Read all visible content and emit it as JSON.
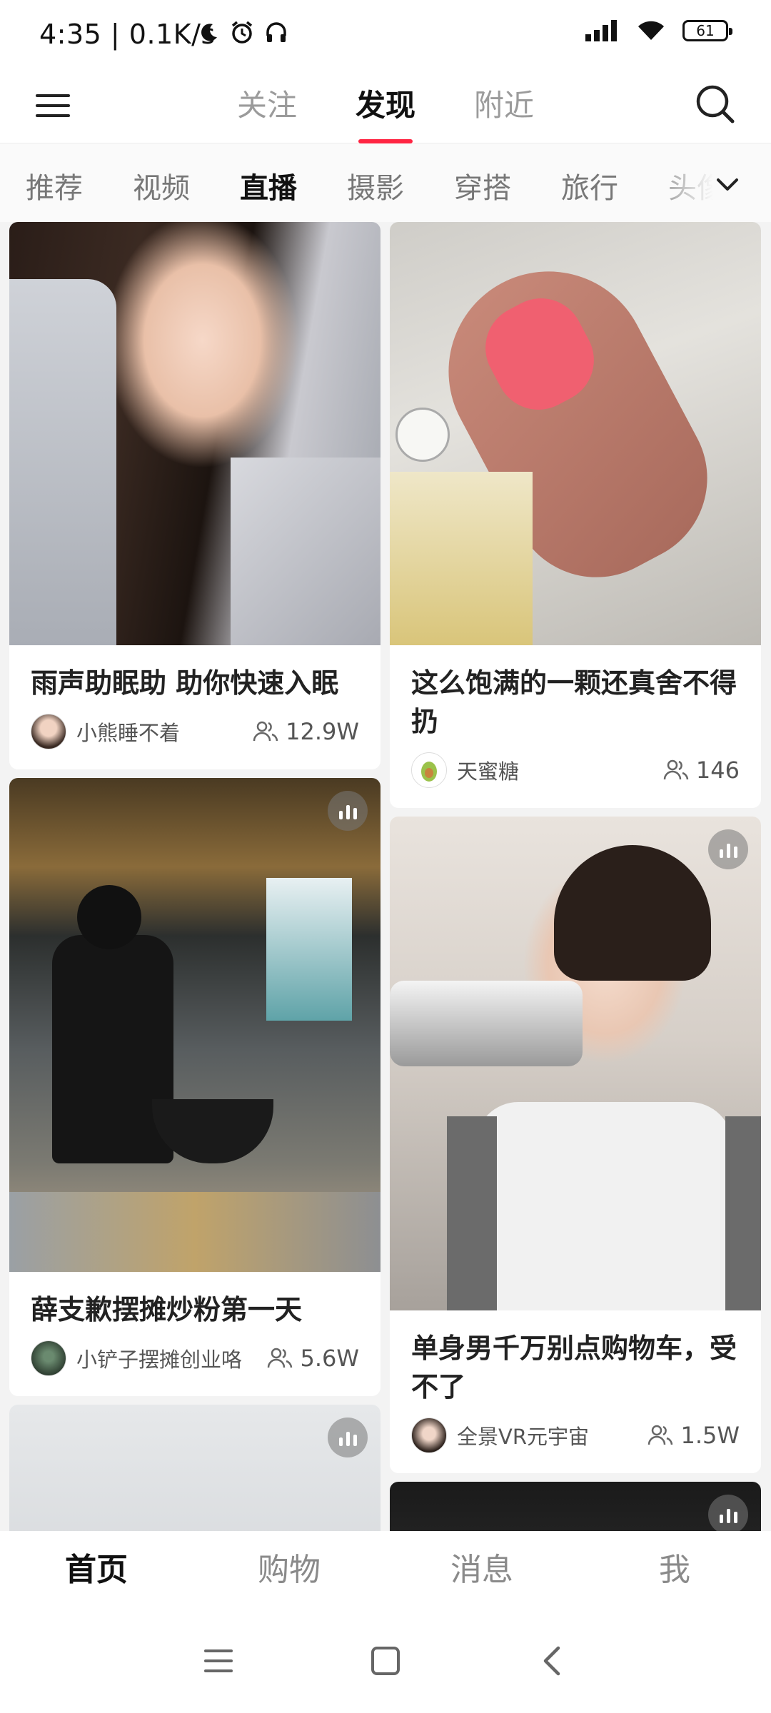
{
  "status_bar": {
    "time": "4:35 | 0.1K/s",
    "battery": "61",
    "icons": [
      "moon-icon",
      "alarm-icon",
      "headphones-icon",
      "signal-icon",
      "wifi-icon",
      "battery-icon"
    ]
  },
  "top_nav": {
    "tabs": [
      {
        "label": "关注"
      },
      {
        "label": "发现",
        "active": true
      },
      {
        "label": "附近"
      }
    ],
    "menu_icon": "menu-icon",
    "search_icon": "search-icon",
    "accent_color": "#ff2442"
  },
  "channels": {
    "items": [
      "推荐",
      "视频",
      "直播",
      "摄影",
      "穿搭",
      "旅行",
      "头像"
    ],
    "active_index": 2,
    "more_icon": "chevron-down-icon"
  },
  "feed": {
    "left": [
      {
        "title": "雨声助眠助 助你快速入眠",
        "author": "小熊睡不着",
        "viewers": "12.9W",
        "live": false
      },
      {
        "title": "薛支歉摆摊炒粉第一天",
        "author": "小铲子摆摊创业咯",
        "viewers": "5.6W",
        "live": true
      },
      {
        "title": "",
        "author": "",
        "viewers": "",
        "live": true
      }
    ],
    "right": [
      {
        "title": "这么饱满的一颗还真舍不得扔",
        "author": "天蜜糖",
        "viewers": "146",
        "live": false
      },
      {
        "title": "单身男千万别点购物车，受不了",
        "author": "全景VR元宇宙",
        "viewers": "1.5W",
        "live": true
      },
      {
        "title": "",
        "author": "",
        "viewers": "",
        "live": true
      }
    ]
  },
  "bottom_nav": {
    "tabs": [
      {
        "label": "首页",
        "active": true
      },
      {
        "label": "购物"
      },
      {
        "label": "消息"
      },
      {
        "label": "我"
      }
    ]
  },
  "system_nav": [
    "recents-icon",
    "home-icon",
    "back-icon"
  ]
}
